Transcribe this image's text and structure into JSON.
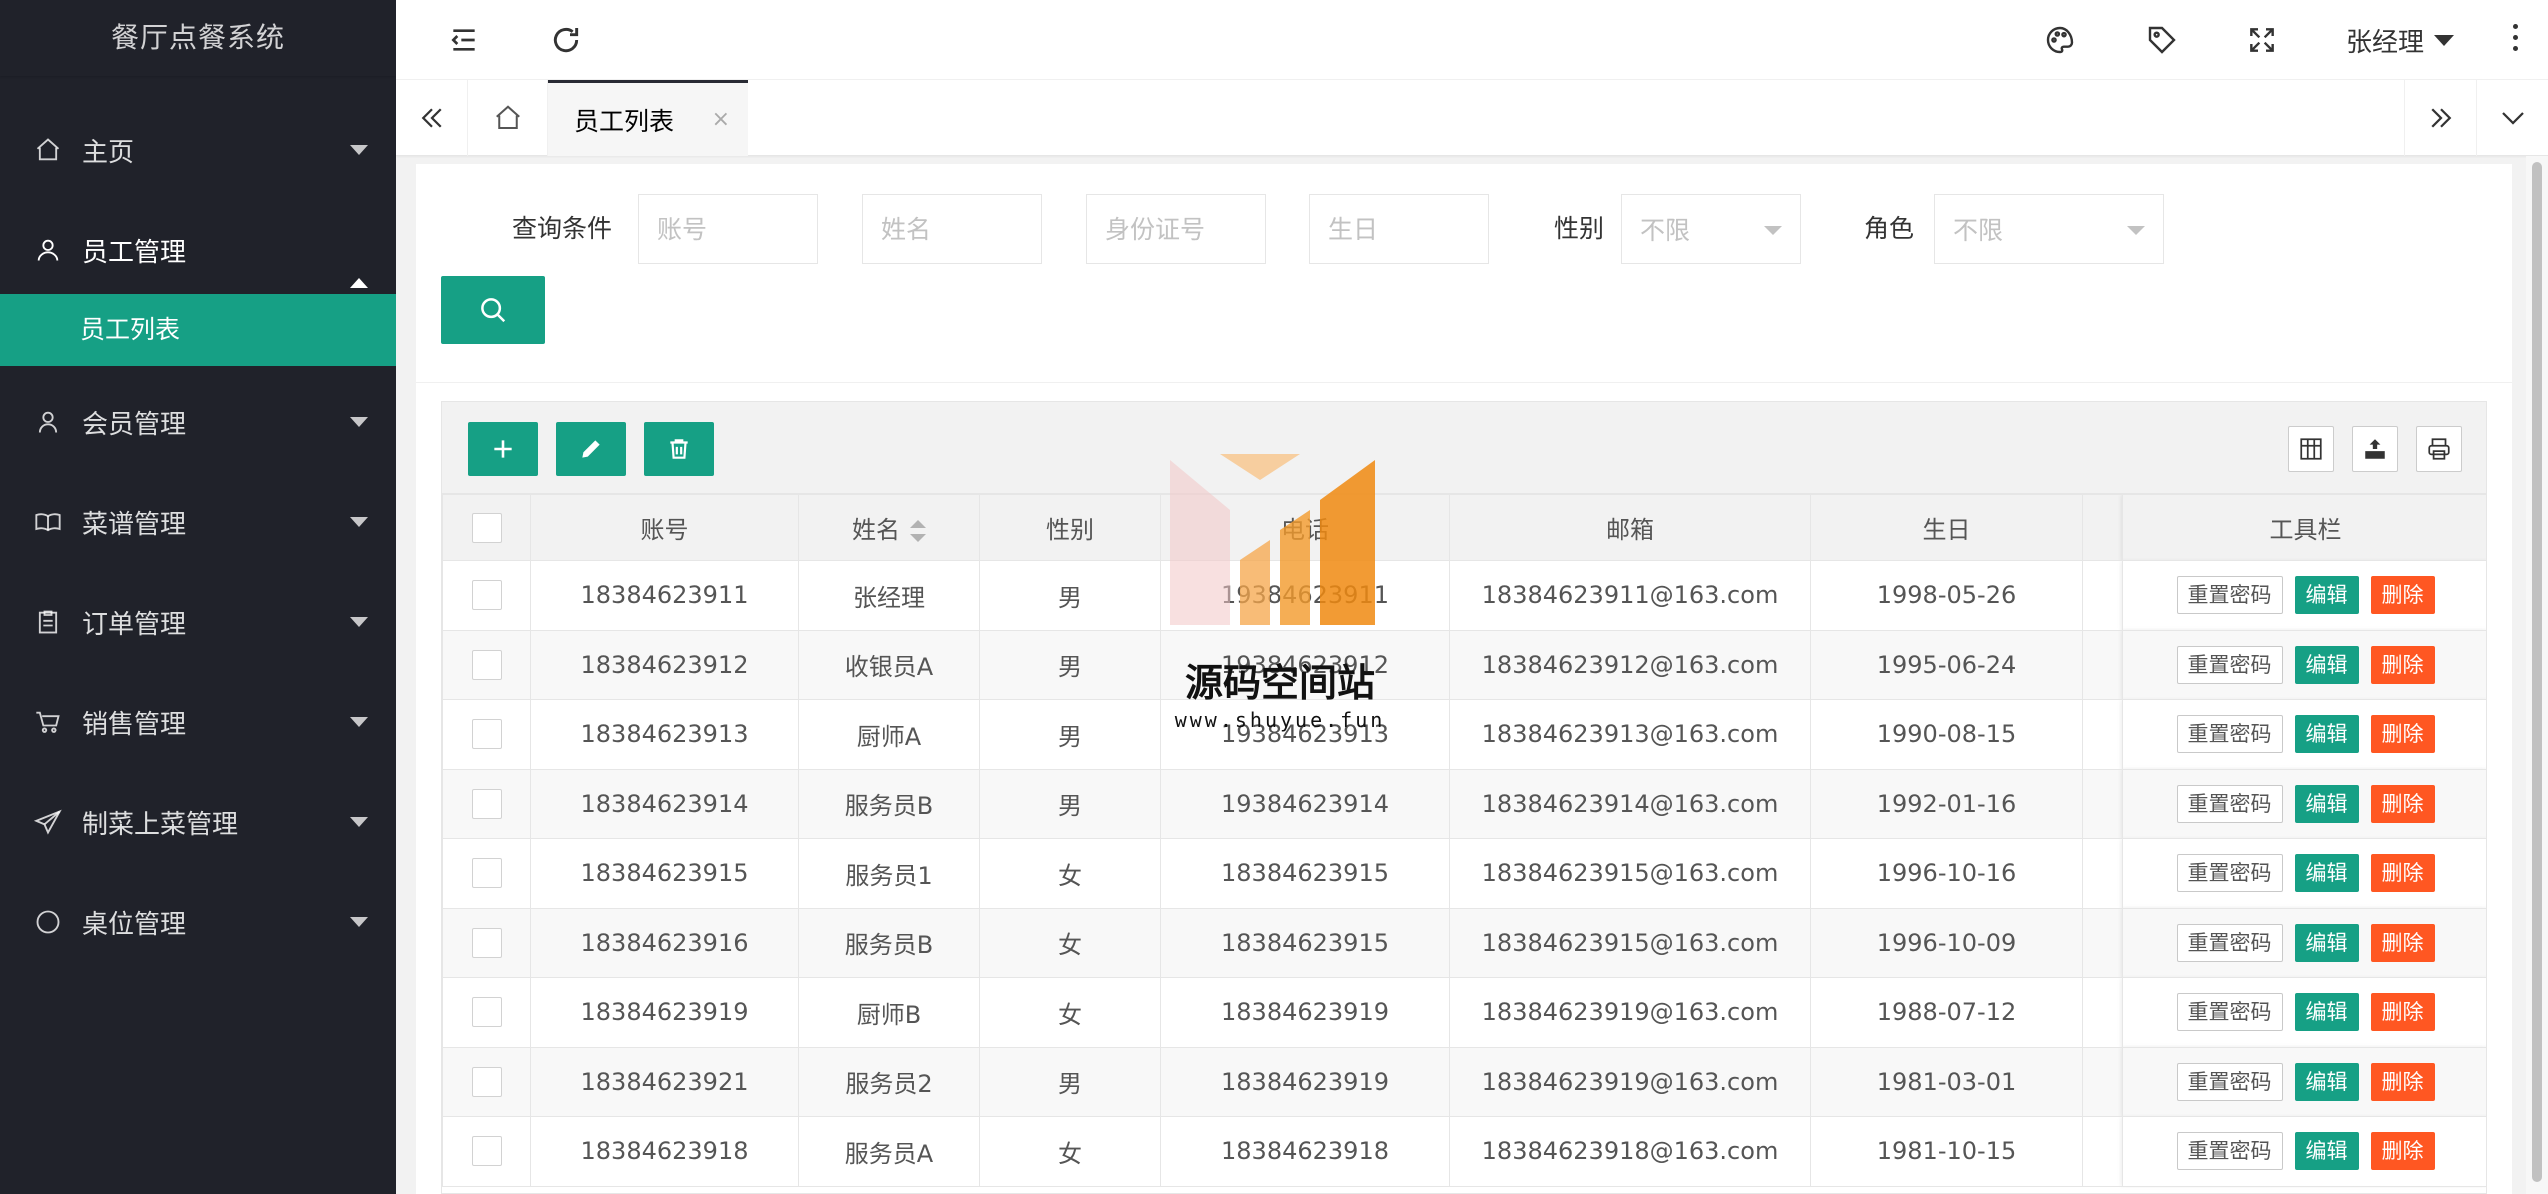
{
  "app": {
    "title": "餐厅点餐系统"
  },
  "sidebar": {
    "items": [
      {
        "label": "主页",
        "icon": "home-icon",
        "expanded": false
      },
      {
        "label": "员工管理",
        "icon": "user-group-icon",
        "expanded": true,
        "children": [
          {
            "label": "员工列表",
            "active": true
          }
        ]
      },
      {
        "label": "会员管理",
        "icon": "user-icon",
        "expanded": false
      },
      {
        "label": "菜谱管理",
        "icon": "book-icon",
        "expanded": false
      },
      {
        "label": "订单管理",
        "icon": "clipboard-icon",
        "expanded": false
      },
      {
        "label": "销售管理",
        "icon": "cart-icon",
        "expanded": false
      },
      {
        "label": "制菜上菜管理",
        "icon": "send-icon",
        "expanded": false
      },
      {
        "label": "桌位管理",
        "icon": "circle-icon",
        "expanded": false
      }
    ]
  },
  "header": {
    "user_name": "张经理",
    "icons": [
      "menu-fold-icon",
      "refresh-icon",
      "theme-icon",
      "tag-icon",
      "fullscreen-icon",
      "more-icon"
    ]
  },
  "tabs": {
    "items": [
      {
        "label": "员工列表",
        "active": true
      }
    ],
    "close_symbol": "×"
  },
  "query": {
    "label": "查询条件",
    "account_placeholder": "账号",
    "name_placeholder": "姓名",
    "idcard_placeholder": "身份证号",
    "birthday_placeholder": "生日",
    "gender_label": "性别",
    "gender_value": "不限",
    "role_label": "角色",
    "role_value": "不限"
  },
  "table": {
    "columns": [
      "账号",
      "姓名",
      "性别",
      "电话",
      "邮箱",
      "生日",
      "工具栏"
    ],
    "row_actions": {
      "reset": "重置密码",
      "edit": "编辑",
      "delete": "删除"
    },
    "rows": [
      {
        "account": "18384623911",
        "name": "张经理",
        "gender": "男",
        "phone": "19384623911",
        "email": "18384623911@163.com",
        "birthday": "1998-05-26"
      },
      {
        "account": "18384623912",
        "name": "收银员A",
        "gender": "男",
        "phone": "19384623912",
        "email": "18384623912@163.com",
        "birthday": "1995-06-24"
      },
      {
        "account": "18384623913",
        "name": "厨师A",
        "gender": "男",
        "phone": "19384623913",
        "email": "18384623913@163.com",
        "birthday": "1990-08-15"
      },
      {
        "account": "18384623914",
        "name": "服务员B",
        "gender": "男",
        "phone": "19384623914",
        "email": "18384623914@163.com",
        "birthday": "1992-01-16"
      },
      {
        "account": "18384623915",
        "name": "服务员1",
        "gender": "女",
        "phone": "18384623915",
        "email": "18384623915@163.com",
        "birthday": "1996-10-16"
      },
      {
        "account": "18384623916",
        "name": "服务员B",
        "gender": "女",
        "phone": "18384623915",
        "email": "18384623915@163.com",
        "birthday": "1996-10-09"
      },
      {
        "account": "18384623919",
        "name": "厨师B",
        "gender": "女",
        "phone": "18384623919",
        "email": "18384623919@163.com",
        "birthday": "1988-07-12"
      },
      {
        "account": "18384623921",
        "name": "服务员2",
        "gender": "男",
        "phone": "18384623919",
        "email": "18384623919@163.com",
        "birthday": "1981-03-01"
      },
      {
        "account": "18384623918",
        "name": "服务员A",
        "gender": "女",
        "phone": "18384623918",
        "email": "18384623918@163.com",
        "birthday": "1981-10-15"
      }
    ]
  },
  "watermark": {
    "title": "源码空间站",
    "url": "www.shuyue.fun"
  },
  "colors": {
    "sidebar_bg": "#20222a",
    "accent": "#16a085",
    "danger": "#ff5722"
  }
}
